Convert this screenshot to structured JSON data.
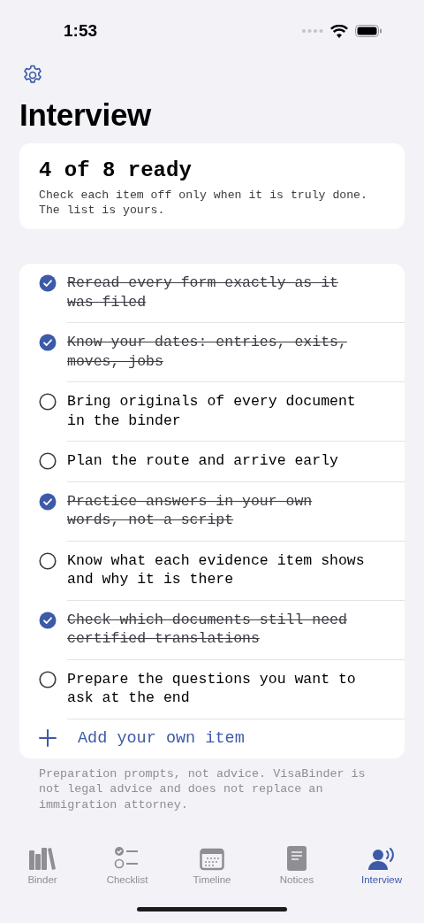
{
  "status_bar": {
    "time": "1:53"
  },
  "title": "Interview",
  "summary": {
    "heading": "4 of 8 ready",
    "note": "Check each item off only when it is truly done. The list is yours."
  },
  "items": [
    {
      "text": "Reread every form exactly as it was filed",
      "checked": true
    },
    {
      "text": "Know your dates: entries, exits, moves, jobs",
      "checked": true
    },
    {
      "text": "Bring originals of every document in the binder",
      "checked": false
    },
    {
      "text": "Plan the route and arrive early",
      "checked": false
    },
    {
      "text": "Practice answers in your own words, not a script",
      "checked": true
    },
    {
      "text": "Know what each evidence item shows and why it is there",
      "checked": false
    },
    {
      "text": "Check which documents still need certified translations",
      "checked": true
    },
    {
      "text": "Prepare the questions you want to ask at the end",
      "checked": false
    }
  ],
  "add_item": {
    "label": "Add your own item"
  },
  "disclaimer": "Preparation prompts, not advice. VisaBinder is not legal advice and does not replace an immigration attorney.",
  "tabs": [
    {
      "label": "Binder",
      "selected": false
    },
    {
      "label": "Checklist",
      "selected": false
    },
    {
      "label": "Timeline",
      "selected": false
    },
    {
      "label": "Notices",
      "selected": false
    },
    {
      "label": "Interview",
      "selected": true
    }
  ]
}
